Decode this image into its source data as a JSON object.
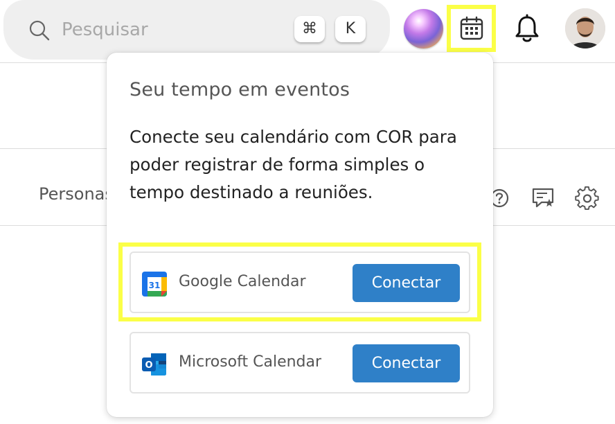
{
  "search": {
    "placeholder": "Pesquisar",
    "shortcut_keys": [
      "⌘",
      "K"
    ]
  },
  "header_icons": [
    "assistant-orb",
    "calendar-icon",
    "bell-icon",
    "user-avatar"
  ],
  "background": {
    "section_label": "Personas",
    "tool_icons": [
      "help-icon",
      "comment-star-icon",
      "gear-icon"
    ]
  },
  "popover": {
    "title": "Seu tempo em eventos",
    "description": "Conecte seu calendário com COR para poder registrar de forma simples o tempo destinado a reuniões.",
    "integrations": [
      {
        "name": "Google Calendar",
        "logo_number": "31",
        "button_label": "Conectar"
      },
      {
        "name": "Microsoft Calendar",
        "logo_letter": "O",
        "button_label": "Conectar"
      }
    ]
  },
  "colors": {
    "highlight": "#fbff47",
    "primary_button": "#2f80c8",
    "search_bg": "#efefef"
  }
}
